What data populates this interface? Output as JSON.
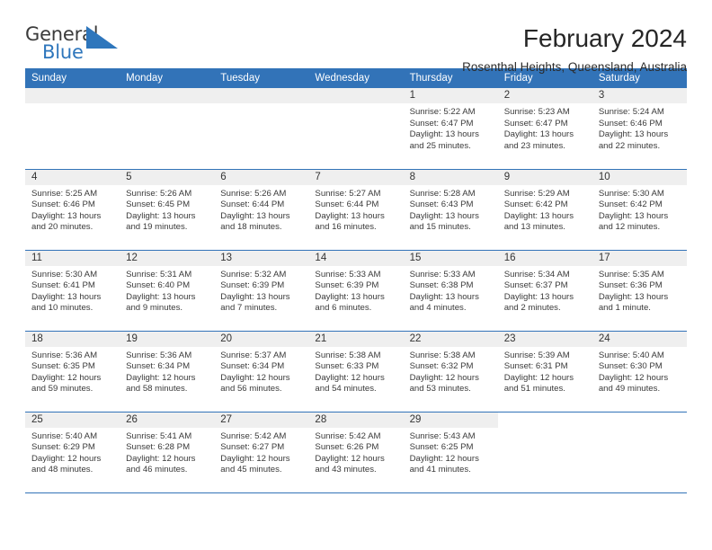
{
  "brand": {
    "name_part1": "General",
    "name_part2": "Blue",
    "flag_color": "#2e76bc"
  },
  "header": {
    "title": "February 2024",
    "subtitle": "Rosenthal Heights, Queensland, Australia"
  },
  "theme": {
    "header_blue": "#3273b8",
    "daynum_band": "#efefef",
    "text": "#3a3a3a"
  },
  "calendar": {
    "weekday_headers": [
      "Sunday",
      "Monday",
      "Tuesday",
      "Wednesday",
      "Thursday",
      "Friday",
      "Saturday"
    ],
    "labels": {
      "sunrise": "Sunrise:",
      "sunset": "Sunset:",
      "daylight": "Daylight:"
    },
    "weeks": [
      [
        {
          "day": "",
          "empty": true
        },
        {
          "day": "",
          "empty": true
        },
        {
          "day": "",
          "empty": true
        },
        {
          "day": "",
          "empty": true
        },
        {
          "day": "1",
          "sunrise": "Sunrise: 5:22 AM",
          "sunset": "Sunset: 6:47 PM",
          "daylight1": "Daylight: 13 hours",
          "daylight2": "and 25 minutes."
        },
        {
          "day": "2",
          "sunrise": "Sunrise: 5:23 AM",
          "sunset": "Sunset: 6:47 PM",
          "daylight1": "Daylight: 13 hours",
          "daylight2": "and 23 minutes."
        },
        {
          "day": "3",
          "sunrise": "Sunrise: 5:24 AM",
          "sunset": "Sunset: 6:46 PM",
          "daylight1": "Daylight: 13 hours",
          "daylight2": "and 22 minutes."
        }
      ],
      [
        {
          "day": "4",
          "sunrise": "Sunrise: 5:25 AM",
          "sunset": "Sunset: 6:46 PM",
          "daylight1": "Daylight: 13 hours",
          "daylight2": "and 20 minutes."
        },
        {
          "day": "5",
          "sunrise": "Sunrise: 5:26 AM",
          "sunset": "Sunset: 6:45 PM",
          "daylight1": "Daylight: 13 hours",
          "daylight2": "and 19 minutes."
        },
        {
          "day": "6",
          "sunrise": "Sunrise: 5:26 AM",
          "sunset": "Sunset: 6:44 PM",
          "daylight1": "Daylight: 13 hours",
          "daylight2": "and 18 minutes."
        },
        {
          "day": "7",
          "sunrise": "Sunrise: 5:27 AM",
          "sunset": "Sunset: 6:44 PM",
          "daylight1": "Daylight: 13 hours",
          "daylight2": "and 16 minutes."
        },
        {
          "day": "8",
          "sunrise": "Sunrise: 5:28 AM",
          "sunset": "Sunset: 6:43 PM",
          "daylight1": "Daylight: 13 hours",
          "daylight2": "and 15 minutes."
        },
        {
          "day": "9",
          "sunrise": "Sunrise: 5:29 AM",
          "sunset": "Sunset: 6:42 PM",
          "daylight1": "Daylight: 13 hours",
          "daylight2": "and 13 minutes."
        },
        {
          "day": "10",
          "sunrise": "Sunrise: 5:30 AM",
          "sunset": "Sunset: 6:42 PM",
          "daylight1": "Daylight: 13 hours",
          "daylight2": "and 12 minutes."
        }
      ],
      [
        {
          "day": "11",
          "sunrise": "Sunrise: 5:30 AM",
          "sunset": "Sunset: 6:41 PM",
          "daylight1": "Daylight: 13 hours",
          "daylight2": "and 10 minutes."
        },
        {
          "day": "12",
          "sunrise": "Sunrise: 5:31 AM",
          "sunset": "Sunset: 6:40 PM",
          "daylight1": "Daylight: 13 hours",
          "daylight2": "and 9 minutes."
        },
        {
          "day": "13",
          "sunrise": "Sunrise: 5:32 AM",
          "sunset": "Sunset: 6:39 PM",
          "daylight1": "Daylight: 13 hours",
          "daylight2": "and 7 minutes."
        },
        {
          "day": "14",
          "sunrise": "Sunrise: 5:33 AM",
          "sunset": "Sunset: 6:39 PM",
          "daylight1": "Daylight: 13 hours",
          "daylight2": "and 6 minutes."
        },
        {
          "day": "15",
          "sunrise": "Sunrise: 5:33 AM",
          "sunset": "Sunset: 6:38 PM",
          "daylight1": "Daylight: 13 hours",
          "daylight2": "and 4 minutes."
        },
        {
          "day": "16",
          "sunrise": "Sunrise: 5:34 AM",
          "sunset": "Sunset: 6:37 PM",
          "daylight1": "Daylight: 13 hours",
          "daylight2": "and 2 minutes."
        },
        {
          "day": "17",
          "sunrise": "Sunrise: 5:35 AM",
          "sunset": "Sunset: 6:36 PM",
          "daylight1": "Daylight: 13 hours",
          "daylight2": "and 1 minute."
        }
      ],
      [
        {
          "day": "18",
          "sunrise": "Sunrise: 5:36 AM",
          "sunset": "Sunset: 6:35 PM",
          "daylight1": "Daylight: 12 hours",
          "daylight2": "and 59 minutes."
        },
        {
          "day": "19",
          "sunrise": "Sunrise: 5:36 AM",
          "sunset": "Sunset: 6:34 PM",
          "daylight1": "Daylight: 12 hours",
          "daylight2": "and 58 minutes."
        },
        {
          "day": "20",
          "sunrise": "Sunrise: 5:37 AM",
          "sunset": "Sunset: 6:34 PM",
          "daylight1": "Daylight: 12 hours",
          "daylight2": "and 56 minutes."
        },
        {
          "day": "21",
          "sunrise": "Sunrise: 5:38 AM",
          "sunset": "Sunset: 6:33 PM",
          "daylight1": "Daylight: 12 hours",
          "daylight2": "and 54 minutes."
        },
        {
          "day": "22",
          "sunrise": "Sunrise: 5:38 AM",
          "sunset": "Sunset: 6:32 PM",
          "daylight1": "Daylight: 12 hours",
          "daylight2": "and 53 minutes."
        },
        {
          "day": "23",
          "sunrise": "Sunrise: 5:39 AM",
          "sunset": "Sunset: 6:31 PM",
          "daylight1": "Daylight: 12 hours",
          "daylight2": "and 51 minutes."
        },
        {
          "day": "24",
          "sunrise": "Sunrise: 5:40 AM",
          "sunset": "Sunset: 6:30 PM",
          "daylight1": "Daylight: 12 hours",
          "daylight2": "and 49 minutes."
        }
      ],
      [
        {
          "day": "25",
          "sunrise": "Sunrise: 5:40 AM",
          "sunset": "Sunset: 6:29 PM",
          "daylight1": "Daylight: 12 hours",
          "daylight2": "and 48 minutes."
        },
        {
          "day": "26",
          "sunrise": "Sunrise: 5:41 AM",
          "sunset": "Sunset: 6:28 PM",
          "daylight1": "Daylight: 12 hours",
          "daylight2": "and 46 minutes."
        },
        {
          "day": "27",
          "sunrise": "Sunrise: 5:42 AM",
          "sunset": "Sunset: 6:27 PM",
          "daylight1": "Daylight: 12 hours",
          "daylight2": "and 45 minutes."
        },
        {
          "day": "28",
          "sunrise": "Sunrise: 5:42 AM",
          "sunset": "Sunset: 6:26 PM",
          "daylight1": "Daylight: 12 hours",
          "daylight2": "and 43 minutes."
        },
        {
          "day": "29",
          "sunrise": "Sunrise: 5:43 AM",
          "sunset": "Sunset: 6:25 PM",
          "daylight1": "Daylight: 12 hours",
          "daylight2": "and 41 minutes."
        },
        {
          "day": "",
          "blank": true
        },
        {
          "day": "",
          "blank": true
        }
      ]
    ]
  }
}
